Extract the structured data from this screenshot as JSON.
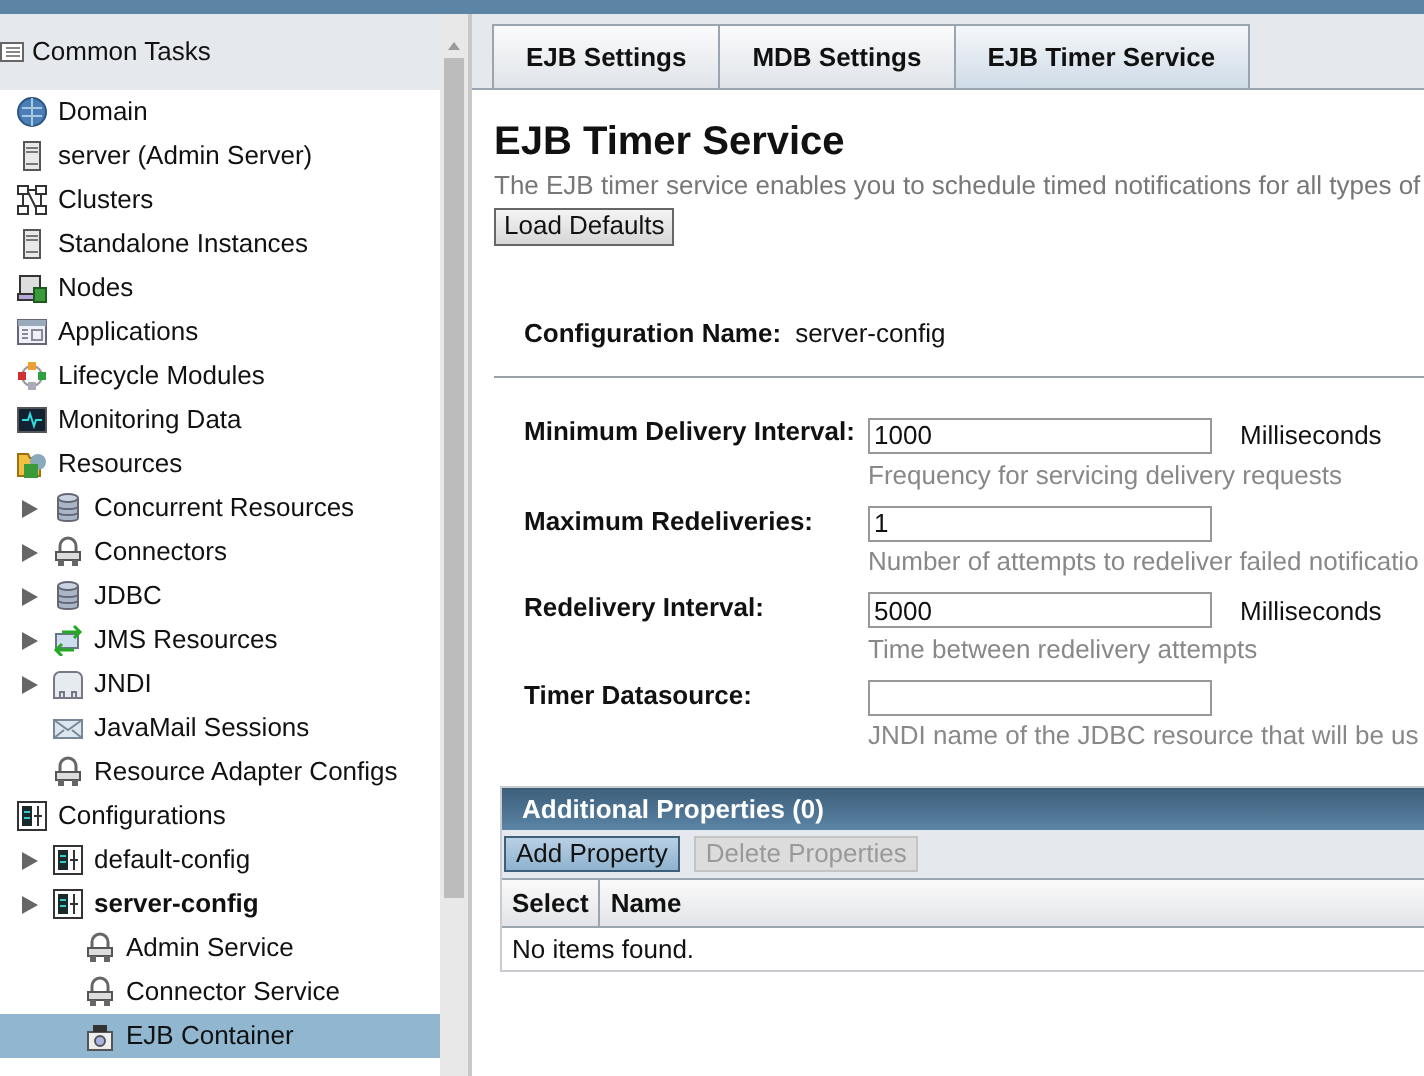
{
  "sidebar": {
    "title": "Common Tasks",
    "tree": [
      {
        "label": "Domain",
        "kind": "globe",
        "selected": false
      },
      {
        "label": "server (Admin Server)",
        "kind": "server",
        "selected": false
      },
      {
        "label": "Clusters",
        "kind": "cluster",
        "selected": false
      },
      {
        "label": "Standalone Instances",
        "kind": "server",
        "selected": false
      },
      {
        "label": "Nodes",
        "kind": "node",
        "selected": false
      },
      {
        "label": "Applications",
        "kind": "app",
        "selected": false
      },
      {
        "label": "Lifecycle Modules",
        "kind": "lifecycle",
        "selected": false
      },
      {
        "label": "Monitoring Data",
        "kind": "monitor",
        "selected": false
      },
      {
        "label": "Resources",
        "kind": "resources",
        "selected": false,
        "children": [
          {
            "label": "Concurrent Resources",
            "kind": "database",
            "expanded": false,
            "selected": false
          },
          {
            "label": "Connectors",
            "kind": "plug",
            "expanded": false,
            "selected": false
          },
          {
            "label": "JDBC",
            "kind": "database",
            "expanded": false,
            "selected": false
          },
          {
            "label": "JMS Resources",
            "kind": "jms",
            "expanded": false,
            "selected": false
          },
          {
            "label": "JNDI",
            "kind": "folder",
            "expanded": false,
            "selected": false
          },
          {
            "label": "JavaMail Sessions",
            "kind": "mail",
            "selected": false
          },
          {
            "label": "Resource Adapter Configs",
            "kind": "plug",
            "selected": false
          }
        ]
      },
      {
        "label": "Configurations",
        "kind": "config",
        "selected": false,
        "children": [
          {
            "label": "default-config",
            "kind": "config",
            "expanded": false,
            "selected": false
          },
          {
            "label": "server-config",
            "kind": "config",
            "expanded": false,
            "bold": true,
            "selected": false,
            "children": [
              {
                "label": "Admin Service",
                "kind": "plug",
                "selected": false
              },
              {
                "label": "Connector Service",
                "kind": "plug",
                "selected": false
              },
              {
                "label": "EJB Container",
                "kind": "container",
                "selected": true
              }
            ]
          }
        ]
      }
    ]
  },
  "tabs": [
    {
      "label": "EJB Settings",
      "selected": false
    },
    {
      "label": "MDB Settings",
      "selected": false
    },
    {
      "label": "EJB Timer Service",
      "selected": true
    }
  ],
  "page": {
    "title": "EJB Timer Service",
    "description": "The EJB timer service enables you to schedule timed notifications for all types of",
    "load_defaults_button": "Load Defaults",
    "config_name_label": "Configuration Name:",
    "config_name_value": "server-config"
  },
  "fields": [
    {
      "label": "Minimum Delivery Interval:",
      "value": "1000",
      "unit": "Milliseconds",
      "help": "Frequency for servicing delivery requests"
    },
    {
      "label": "Maximum Redeliveries:",
      "value": "1",
      "help": "Number of attempts to redeliver failed notificatio"
    },
    {
      "label": "Redelivery Interval:",
      "value": "5000",
      "unit": "Milliseconds",
      "help": "Time between redelivery attempts"
    },
    {
      "label": "Timer Datasource:",
      "help": "JNDI name of the JDBC resource that will be us"
    }
  ],
  "properties_table": {
    "title": "Additional Properties (0)",
    "buttons": [
      {
        "label": "Add Property",
        "disabled": false
      },
      {
        "label": "Delete Properties",
        "disabled": true
      }
    ],
    "columns": [
      "Select",
      "Name"
    ],
    "empty_message": "No items found."
  }
}
